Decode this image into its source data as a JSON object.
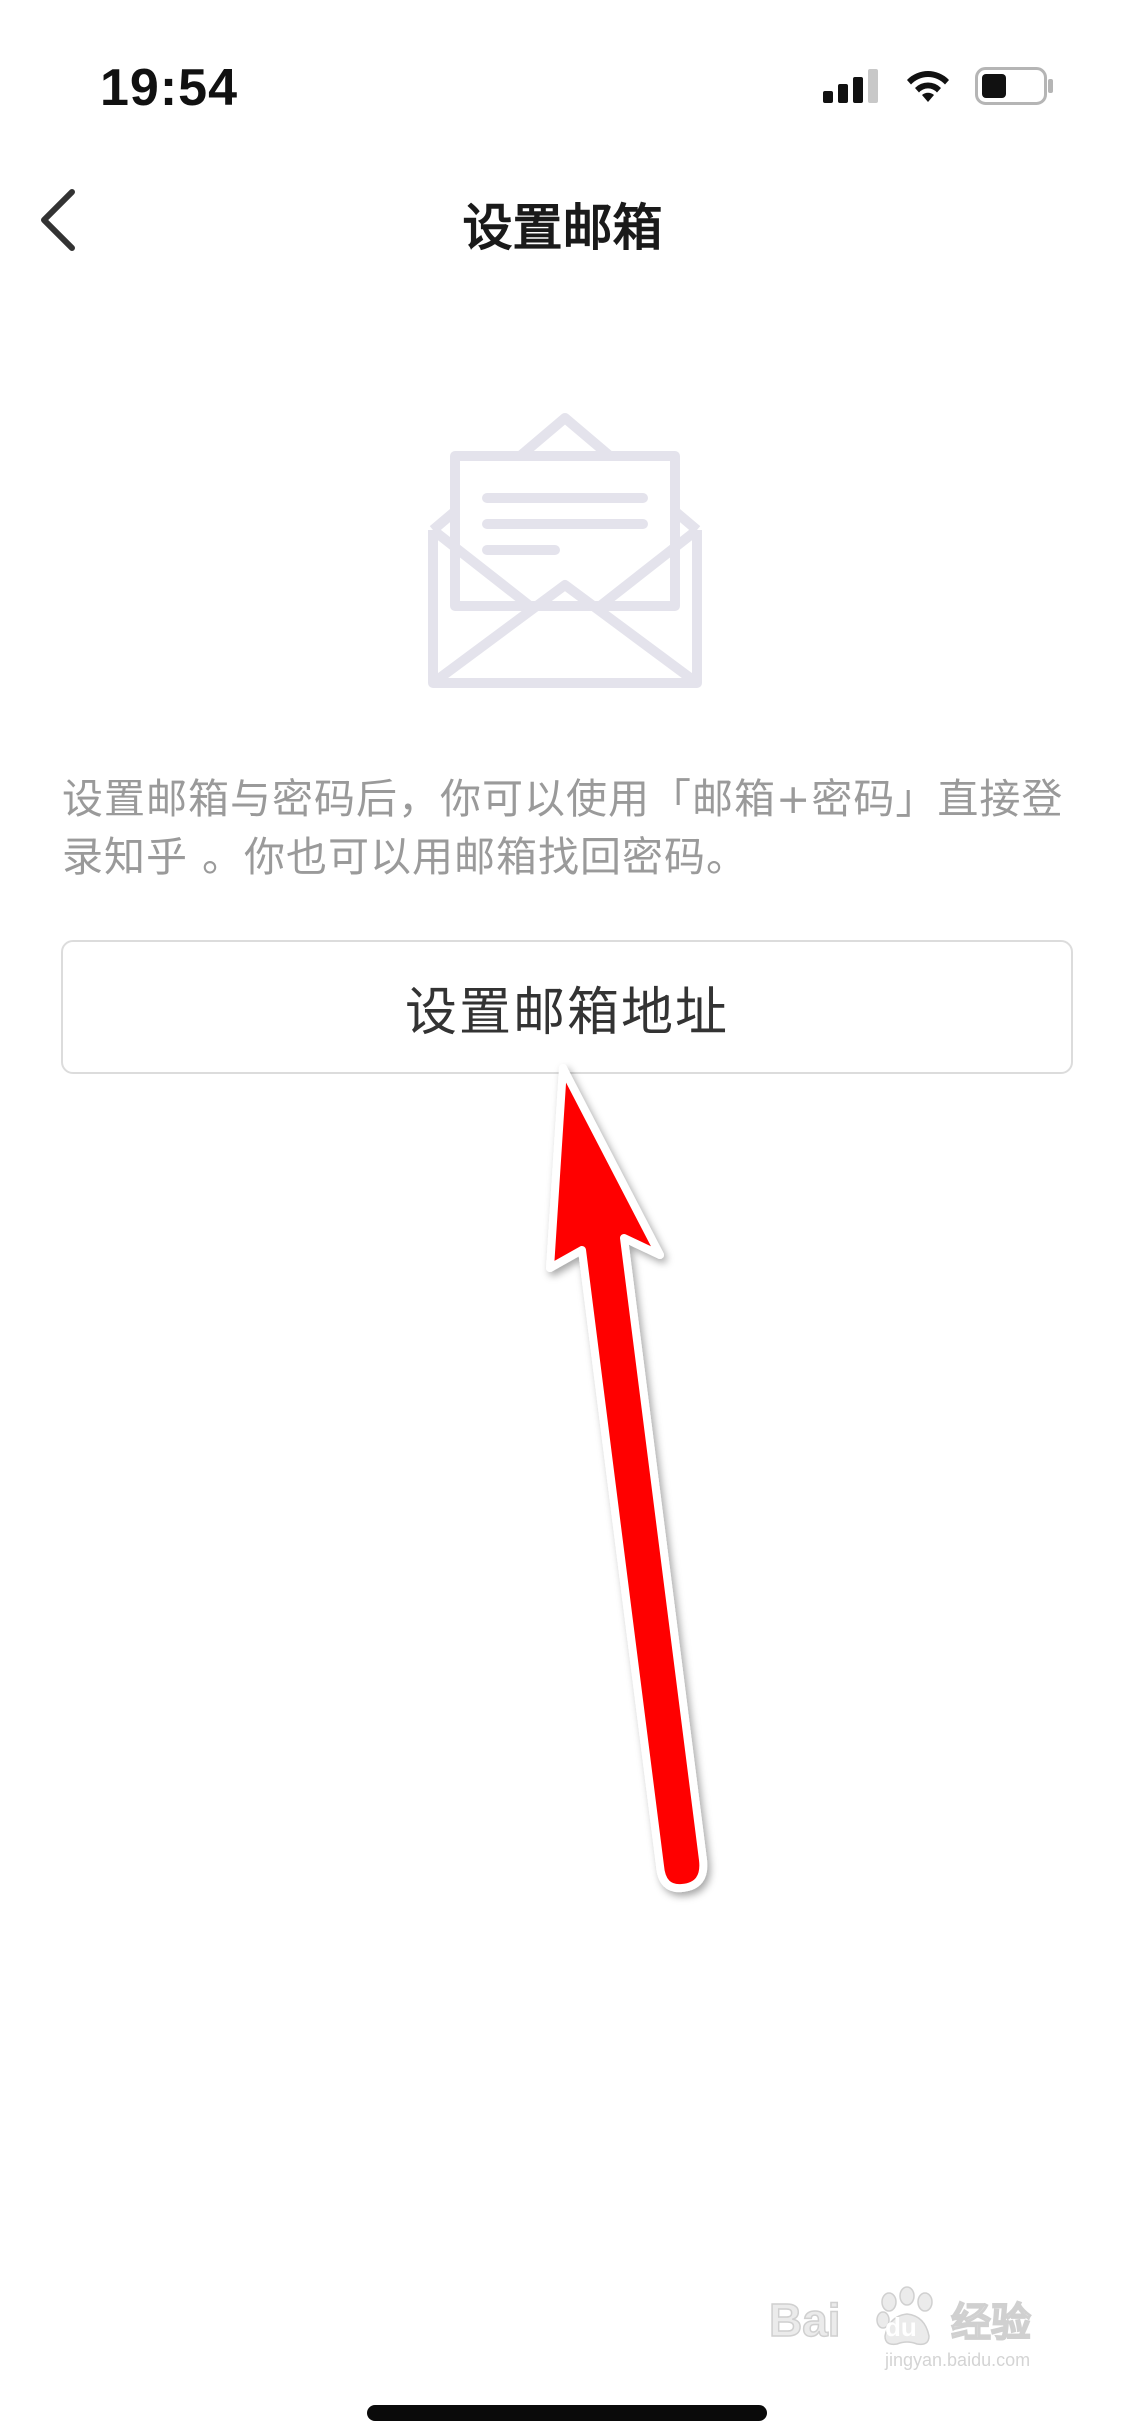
{
  "status_bar": {
    "time": "19:54",
    "icons": [
      "signal-icon",
      "wifi-icon",
      "battery-icon"
    ]
  },
  "nav": {
    "back_icon": "chevron-left-icon",
    "title": "设置邮箱"
  },
  "illustration": {
    "icon": "envelope-open-icon",
    "color": "#e4e3ec"
  },
  "description": "设置邮箱与密码后，你可以使用「邮箱+密码」直接登录知乎 。你也可以用邮箱找回密码。",
  "button": {
    "label": "设置邮箱地址"
  },
  "annotation": {
    "icon": "red-arrow-icon",
    "color": "#ff0000"
  },
  "watermark": {
    "brand": "Bai du",
    "text": "经验",
    "subtext": "jingyan.baidu.com"
  },
  "colors": {
    "background": "#ffffff",
    "description_text": "#9a9a9a",
    "button_border": "#dcdcdc"
  }
}
